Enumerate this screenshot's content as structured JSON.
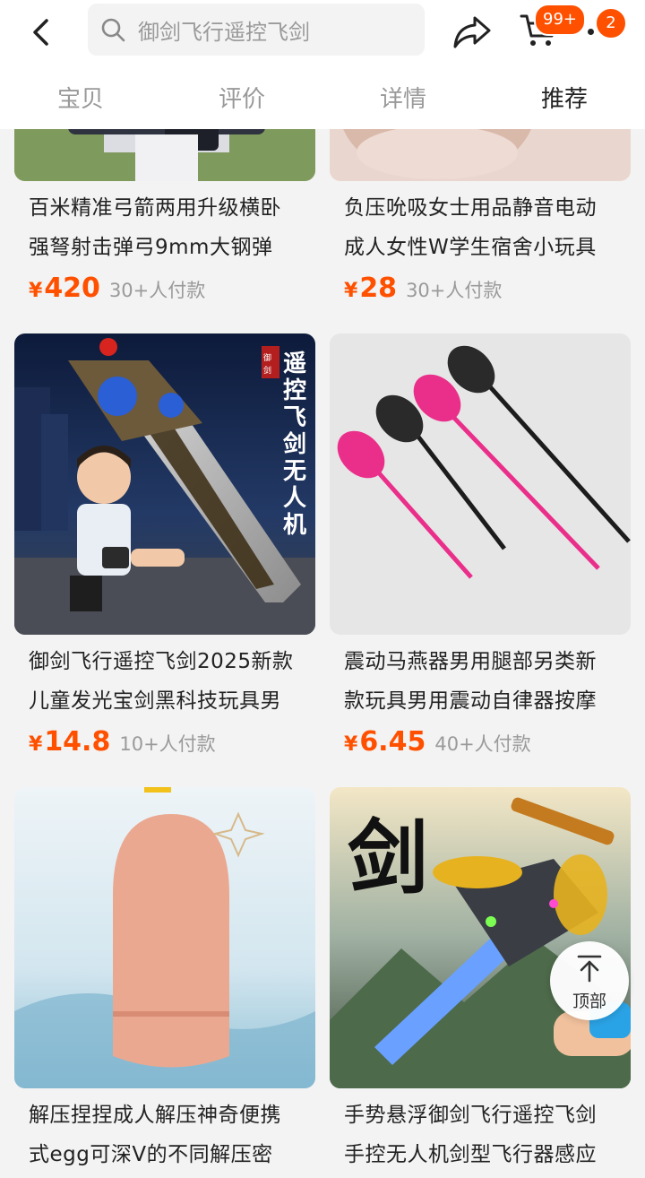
{
  "header": {
    "search_placeholder": "御剑飞行遥控飞剑",
    "cart_badge": "99+",
    "message_badge": "2",
    "icons": [
      "back-arrow-icon",
      "search-icon",
      "share-icon",
      "cart-icon",
      "more-icon"
    ]
  },
  "tabs": [
    {
      "label": "宝贝",
      "active": false
    },
    {
      "label": "评价",
      "active": false
    },
    {
      "label": "详情",
      "active": false
    },
    {
      "label": "推荐",
      "active": true
    }
  ],
  "products": [
    {
      "title_line1": "百米精准弓箭两用升级横卧",
      "title_line2": "强弩射击弹弓9mm大钢弹",
      "currency": "¥",
      "price": "420",
      "sold": "30+人付款"
    },
    {
      "title_line1": "负压吮吸女士用品静音电动",
      "title_line2": "成人女性W学生宿舍小玩具",
      "currency": "¥",
      "price": "28",
      "sold": "30+人付款"
    },
    {
      "title_line1": "御剑飞行遥控飞剑2025新款",
      "title_line2": "儿童发光宝剑黑科技玩具男",
      "currency": "¥",
      "price": "14.8",
      "sold": "10+人付款",
      "image_text": "遥控飞剑无人机",
      "seal": "御剑"
    },
    {
      "title_line1": "震动马燕器男用腿部另类新",
      "title_line2": "款玩具男用震动自律器按摩",
      "currency": "¥",
      "price": "6.45",
      "sold": "40+人付款"
    },
    {
      "title_line1": "解压捏捏成人解压神奇便携",
      "title_line2": "式egg可深V的不同解压密"
    },
    {
      "title_line1": "手势悬浮御剑飞行遥控飞剑",
      "title_line2": "手控无人机剑型飞行器感应",
      "image_text": "剑"
    }
  ],
  "back_to_top_label": "顶部",
  "colors": {
    "accent": "#ff5000",
    "muted": "#9a9a9a",
    "text": "#222222"
  }
}
